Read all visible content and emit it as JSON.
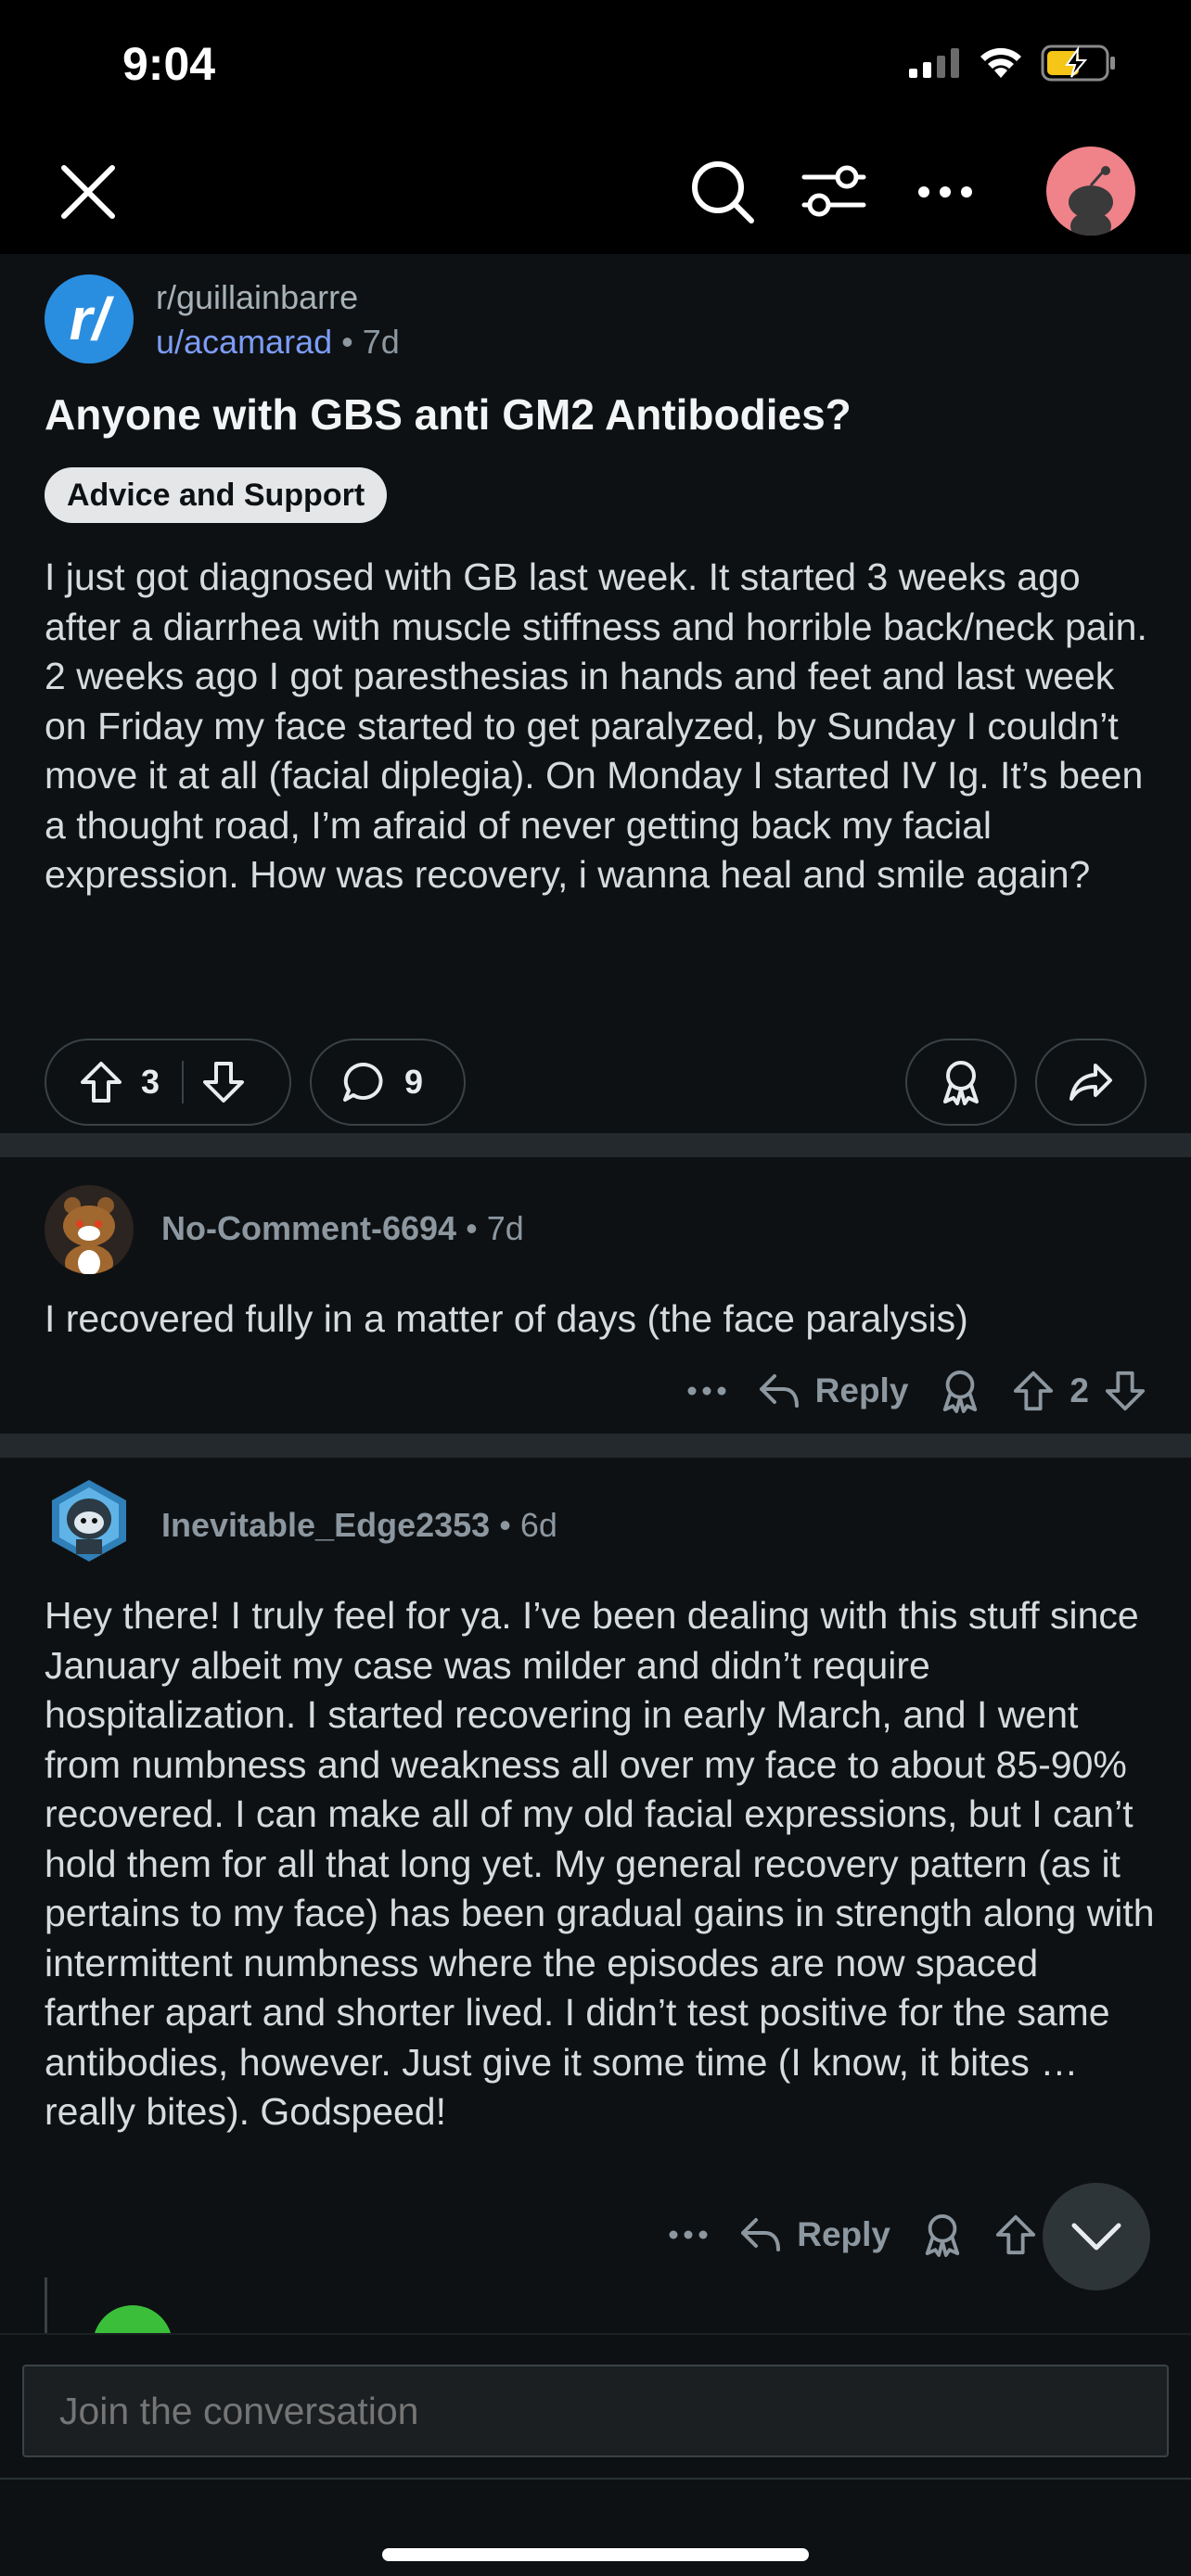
{
  "status_bar": {
    "time": "9:04"
  },
  "post": {
    "subreddit": "r/guillainbarre",
    "author": "u/acamarad",
    "age": "7d",
    "title": "Anyone with GBS anti GM2 Antibodies?",
    "flair": "Advice and Support",
    "body": "I just got diagnosed with GB last week. It started 3 weeks ago after a diarrhea with muscle stiffness and horrible back/neck pain. 2 weeks ago I got paresthesias in hands and feet and last week on Friday my face started to get paralyzed, by Sunday I couldn’t move it at all (facial diplegia). On Monday I started IV Ig. It’s been a thought road, I’m afraid of never getting back my facial expression. How was recovery, i wanna heal and smile again?",
    "upvotes": "3",
    "comments": "9"
  },
  "comments": [
    {
      "user": "No-Comment-6694",
      "age": "7d",
      "body": "I recovered fully in a matter of days (the face paralysis)",
      "reply_label": "Reply",
      "votes": "2"
    },
    {
      "user": "Inevitable_Edge2353",
      "age": "6d",
      "body": "Hey there! I truly feel for ya. I’ve been dealing with this stuff since January albeit my case was milder and didn’t require hospitalization. I started recovering in early March, and I went from numbness and weakness all over my face to about 85-90% recovered.  I can make all of my old facial expressions, but I can’t hold them for all that long yet. My general recovery pattern (as it pertains to my face) has been gradual gains in strength along with intermittent numbness where the episodes are now spaced farther apart and shorter lived. I didn’t test positive for the same antibodies, however. Just give it some time (I know, it bites … really bites). Godspeed!",
      "reply_label": "Reply"
    }
  ],
  "composer": {
    "placeholder": "Join the conversation"
  },
  "colors": {
    "background": "#0e1113",
    "separator": "#23292d",
    "link": "#7c9cf6",
    "subreddit_icon": "#2a8ee0",
    "flair_bg": "#e4e6e8"
  }
}
